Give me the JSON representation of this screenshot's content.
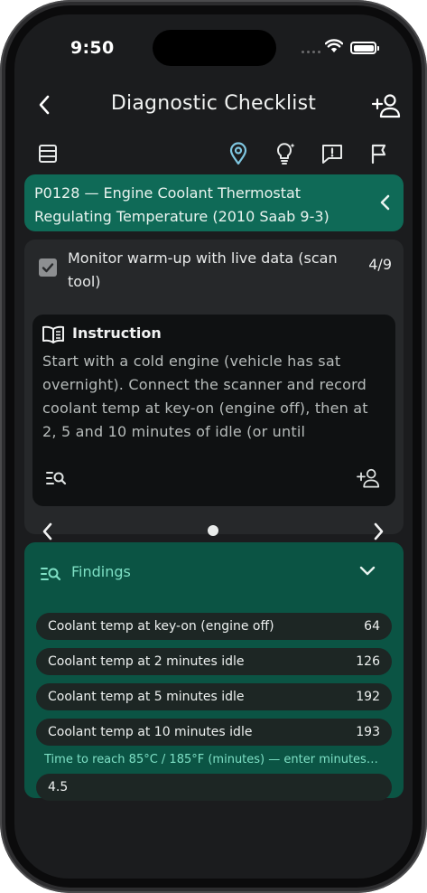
{
  "status_bar": {
    "time": "9:50"
  },
  "header": {
    "title": "Diagnostic Checklist"
  },
  "toolbar": {
    "icons": [
      "list-icon",
      "location-pin-icon",
      "lightbulb-icon",
      "report-icon",
      "flag-icon"
    ],
    "active": "location-pin-icon"
  },
  "diagnosis": {
    "code_line": "P0128 — Engine Coolant Thermostat Regulating Temperature (2010 Saab 9-3)"
  },
  "step": {
    "title": "Monitor warm-up with live data (scan tool)",
    "counter": "4/9",
    "checked": true,
    "instruction_heading": "Instruction",
    "instruction_body": "Start with a cold engine (vehicle has sat overnight). Connect the scanner and record coolant temp at key-on (engine off), then at 2, 5 and 10 minutes of idle (or until thermostat"
  },
  "findings": {
    "title": "Findings",
    "rows": [
      {
        "label": "Coolant temp at key-on (engine off)",
        "value": "64"
      },
      {
        "label": "Coolant temp at 2 minutes idle",
        "value": "126"
      },
      {
        "label": "Coolant temp at 5 minutes idle",
        "value": "192"
      },
      {
        "label": "Coolant temp at 10 minutes idle",
        "value": "193"
      }
    ],
    "time_label": "Time to reach 85°C / 185°F (minutes) — enter minutes…",
    "time_value": "4.5"
  },
  "colors": {
    "accent_teal": "#0f6a57",
    "findings_bg": "#0b5444",
    "findings_text": "#7ee0c5",
    "active_icon": "#7fc6e0"
  }
}
